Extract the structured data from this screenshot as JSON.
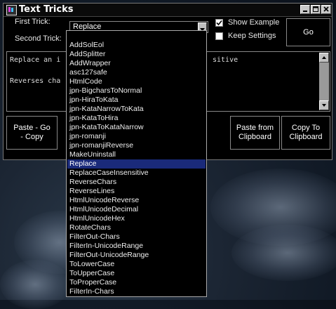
{
  "window": {
    "title": "Text Tricks",
    "icon": "app-icon",
    "controls": [
      "minimize",
      "maximize",
      "close"
    ]
  },
  "form": {
    "first_trick_label": "First Trick:",
    "first_trick_value": "Replace",
    "second_trick_label": "Second Trick:",
    "show_example_label": "Show Example",
    "show_example_checked": true,
    "keep_settings_label": "Keep Settings",
    "keep_settings_checked": false,
    "go_label": "Go"
  },
  "textarea": {
    "line1": "Replace an i                                    sitive",
    "line2": "Reverses cha"
  },
  "buttons": {
    "paste_go_copy": "Paste - Go - Copy",
    "paste_from_clipboard": "Paste from Clipboard",
    "copy_to_clipboard": "Copy To Clipboard"
  },
  "dropdown": {
    "selected_index": 14,
    "items": [
      "AddSolEol",
      "AddSplitter",
      "AddWrapper",
      "asc127safe",
      "HtmlCode",
      "jpn-BigcharsToNormal",
      "jpn-HiraToKata",
      "jpn-KataNarrowToKata",
      "jpn-KataToHira",
      "jpn-KataToKataNarrow",
      "jpn-romanji",
      "jpn-romanjiReverse",
      "MakeUninstall",
      "Replace",
      "ReplaceCaseInsensitive",
      "ReverseChars",
      "ReverseLines",
      "HtmlUnicodeReverse",
      "HtmlUnicodeDecimal",
      "HtmlUnicodeHex",
      "RotateChars",
      "FilterOut-Chars",
      "FilterIn-UnicodeRange",
      "FilterOut-UnicodeRange",
      "ToLowerCase",
      "ToUpperCase",
      "ToProperCase",
      "FilterIn-Chars"
    ]
  }
}
